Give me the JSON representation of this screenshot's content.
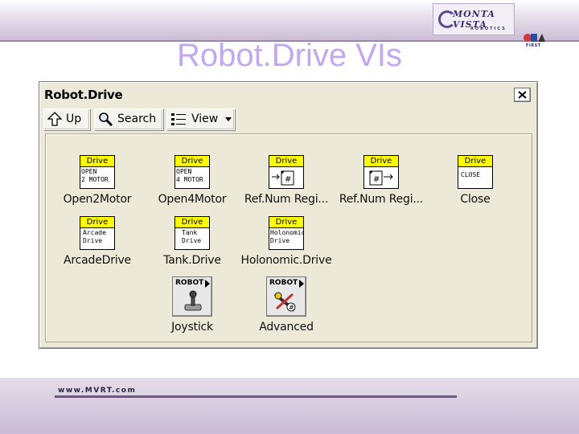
{
  "slide": {
    "title": "Robot.Drive VIs",
    "footer_url": "www.MVRT.com",
    "logo_text": "MONTA VISTA",
    "logo_sub": "ROBOTICS",
    "first_logo_text": "FIRST"
  },
  "window": {
    "title": "Robot.Drive",
    "close_glyph": "X"
  },
  "toolbar": {
    "up_label": "Up",
    "search_label": "Search",
    "view_label": "View"
  },
  "colors": {
    "title_color": "#c2a8ef",
    "vi_header_yellow": "#ffff00",
    "window_bg": "#ece9d8"
  },
  "palette": {
    "items": [
      {
        "label": "Open2Motor",
        "header": "Drive",
        "icon_text": "OPEN\n2 MOTOR",
        "icon": "vi-drive-icon"
      },
      {
        "label": "Open4Motor",
        "header": "Drive",
        "icon_text": "OPEN\n4 MOTOR",
        "icon": "vi-drive-icon"
      },
      {
        "label": "Ref.Num Regi...",
        "header": "Drive",
        "icon_text": "",
        "icon": "refnum-register-set-icon"
      },
      {
        "label": "Ref.Num Regi...",
        "header": "Drive",
        "icon_text": "",
        "icon": "refnum-register-get-icon"
      },
      {
        "label": "Close",
        "header": "Drive",
        "icon_text": "CLOSE",
        "icon": "vi-drive-icon"
      },
      {
        "label": "ArcadeDrive",
        "header": "Drive",
        "icon_text": "Arcade\nDrive",
        "icon": "vi-drive-icon"
      },
      {
        "label": "Tank.Drive",
        "header": "Drive",
        "icon_text": "Tank\nDrive",
        "icon": "vi-drive-icon"
      },
      {
        "label": "Holonomic.Drive",
        "header": "Drive",
        "icon_text": "Holonomic\nDrive",
        "icon": "vi-drive-icon"
      },
      {
        "label": "Joystick",
        "header": "ROBOT",
        "icon_text": "",
        "icon": "joystick-icon"
      },
      {
        "label": "Advanced",
        "header": "ROBOT",
        "icon_text": "",
        "icon": "advanced-tools-icon"
      }
    ]
  }
}
